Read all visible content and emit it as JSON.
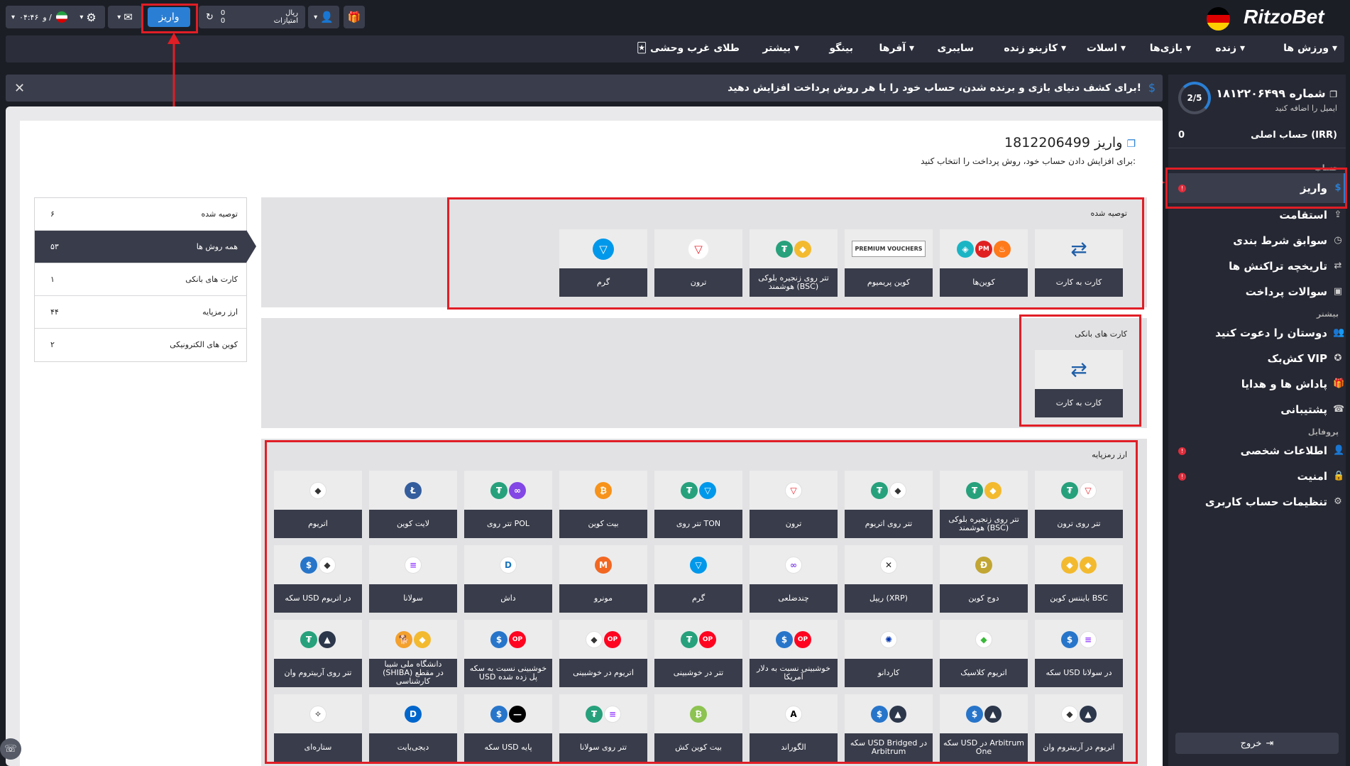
{
  "header": {
    "brand": "RitzoBet",
    "deposit_button": "واریز",
    "balance_label": "ریال",
    "points_label": "امتیازات",
    "balance_value": "0",
    "points_value": "0",
    "time": "۰۴:۴۶",
    "lang_sep": "و /"
  },
  "nav": {
    "items": [
      "ورزش ها",
      "زنده",
      "بازی‌ها",
      "اسلات",
      "کازینو زنده",
      "سایبری",
      "آفرها",
      "بینگو",
      "بیشتر",
      "طلای غرب وحشی"
    ]
  },
  "notice": {
    "text": "برای کشف دنیای بازی و برنده شدن، حساب خود را با هر روش پرداخت افزایش دهید!"
  },
  "account": {
    "number": "شماره ۱۸۱۲۲۰۶۴۹۹",
    "email_hint": "ایمیل را اضافه کنید",
    "progress": "2/5",
    "progress_fraction": 0.4,
    "main_account_label": "حساب اصلی (IRR)",
    "main_account_value": "0"
  },
  "menu": {
    "section_account": "حساب",
    "items_account": [
      "واریز",
      "استقامت",
      "سوابق شرط بندی",
      "تاریخچه تراکنش ها",
      "سوالات پرداخت"
    ],
    "section_more": "بیشتر",
    "items_more": [
      "دوستان را دعوت کنید",
      "کش‌بک VIP",
      "پاداش ها و هدایا",
      "پشتیبانی"
    ],
    "section_profile": "پروفایل",
    "items_profile": [
      "اطلاعات شخصی",
      "امنیت",
      "تنظیمات حساب کاربری"
    ],
    "logout": "خروج"
  },
  "main": {
    "title": "واریز 1812206499",
    "subtitle": "برای افزایش دادن حساب خود، روش پرداخت را انتخاب کنید:",
    "filters": [
      {
        "label": "توصیه شده",
        "count": "۶"
      },
      {
        "label": "همه روش ها",
        "count": "۵۳"
      },
      {
        "label": "کارت های بانکی",
        "count": "۱"
      },
      {
        "label": "ارز رمزپایه",
        "count": "۴۴"
      },
      {
        "label": "کوین های الکترونیکی",
        "count": "۲"
      }
    ],
    "recommended_title": "توصیه شده",
    "recommended": [
      "کارت به کارت",
      "کوین‌ها",
      "کوین پریمیوم",
      "تتر روی زنجیره بلوکی هوشمند (BSC)",
      "ترون",
      "گرم"
    ],
    "bank_title": "کارت های بانکی",
    "bank": [
      "کارت به کارت"
    ],
    "crypto_title": "ارز رمزپایه",
    "crypto": [
      "تتر روی ترون",
      "تتر روی زنجیره بلوکی هوشمند (BSC)",
      "تتر روی اتریوم",
      "ترون",
      "تتر روی TON",
      "بیت کوین",
      "تتر روی POL",
      "لایت کوین",
      "اتریوم",
      "بایننس کوین BSC",
      "دوج کوین",
      "ریپل (XRP)",
      "چندضلعی",
      "گرم",
      "مونرو",
      "داش",
      "سولانا",
      "سکه USD در اتریوم",
      "سکه USD در سولانا",
      "اتریوم کلاسیک",
      "کاردانو",
      "خوشبینی نسبت به دلار آمریکا",
      "تتر در خوشبینی",
      "اتریوم در خوشبینی",
      "خوشبینی نسبت به سکه USD پل زده شده",
      "دانشگاه ملی شیبا (SHIBA) در مقطع کارشناسی",
      "تتر روی آربیتروم وان",
      "اتریوم در آربیتروم وان",
      "سکه USD در Arbitrum One",
      "سکه USD Bridged در Arbitrum",
      "الگوراند",
      "بیت کوین کش",
      "تتر روی سولانا",
      "سکه USD پایه",
      "دیجی‌بایت",
      "ستاره‌ای"
    ],
    "premium_voucher_text": "PREMIUM VOUCHERS"
  },
  "colors": {
    "accent": "#2a7fd4",
    "highlight": "#e01e26",
    "card_label_bg": "#393c4a"
  }
}
